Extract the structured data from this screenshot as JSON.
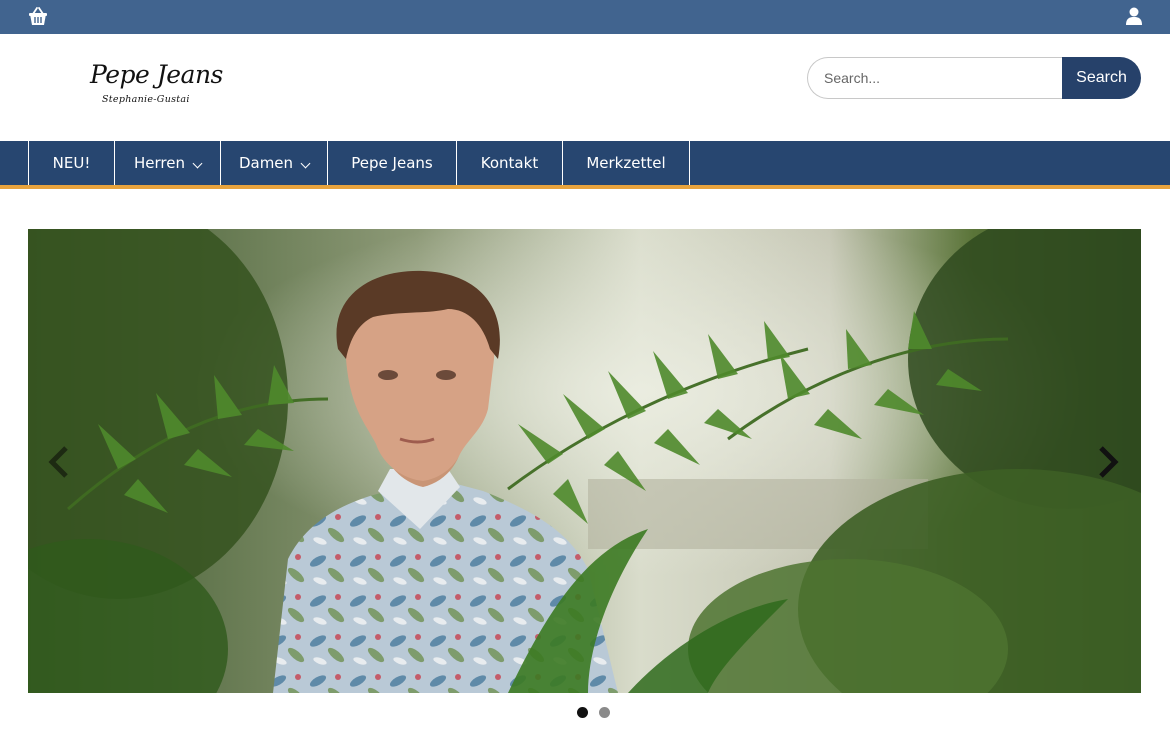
{
  "topbar": {
    "cart_icon": "basket-icon",
    "account_icon": "user-icon",
    "color": "#41648f"
  },
  "header": {
    "logo_brand": "Pepe Jeans",
    "logo_subtitle": "Stephanie-Gustai"
  },
  "search": {
    "placeholder": "Search...",
    "button_label": "Search"
  },
  "nav": {
    "color": "#274670",
    "accent_color": "#e8a33d",
    "items": [
      {
        "label": "NEU!",
        "has_dropdown": false
      },
      {
        "label": "Herren",
        "has_dropdown": true
      },
      {
        "label": "Damen",
        "has_dropdown": true
      },
      {
        "label": "Pepe Jeans",
        "has_dropdown": false
      },
      {
        "label": "Kontakt",
        "has_dropdown": false
      },
      {
        "label": "Merkzettel",
        "has_dropdown": false
      }
    ]
  },
  "slider": {
    "prev_icon": "chevron-left-icon",
    "next_icon": "chevron-right-icon",
    "slide_count": 2,
    "active_slide": 1
  }
}
